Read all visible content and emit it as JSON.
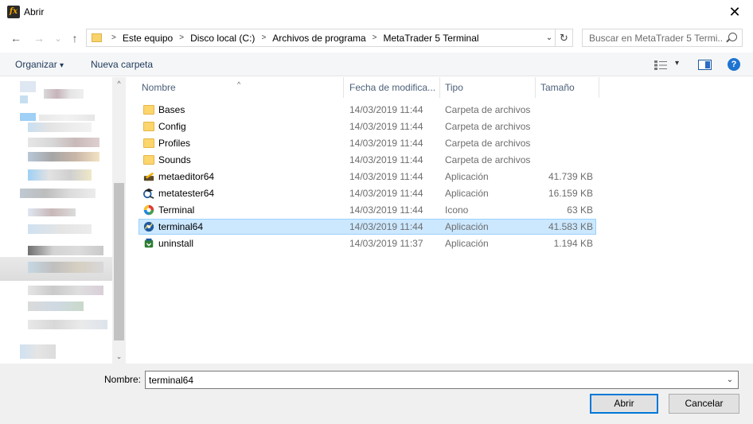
{
  "window": {
    "title": "Abrir",
    "app_icon_text": "fx",
    "close_glyph": "✕"
  },
  "nav": {
    "back": "←",
    "forward": "→",
    "recent": "⌄",
    "up": "↑"
  },
  "address": {
    "crumbs": [
      "Este equipo",
      "Disco local (C:)",
      "Archivos de programa",
      "MetaTrader 5 Terminal"
    ],
    "separator": ">",
    "dropdown": "⌄",
    "refresh": "↻"
  },
  "search": {
    "placeholder": "Buscar en MetaTrader 5 Termi..."
  },
  "toolbar": {
    "organize": "Organizar",
    "organize_arrow": "▾",
    "new_folder": "Nueva carpeta",
    "view_arrow": "▾",
    "help": "?"
  },
  "columns": {
    "name": "Nombre",
    "date": "Fecha de modifica...",
    "type": "Tipo",
    "size": "Tamaño",
    "sort_indicator": "^"
  },
  "files": [
    {
      "name": "Bases",
      "date": "14/03/2019 11:44",
      "type": "Carpeta de archivos",
      "size": "",
      "icon": "folder-icon"
    },
    {
      "name": "Config",
      "date": "14/03/2019 11:44",
      "type": "Carpeta de archivos",
      "size": "",
      "icon": "folder-icon"
    },
    {
      "name": "Profiles",
      "date": "14/03/2019 11:44",
      "type": "Carpeta de archivos",
      "size": "",
      "icon": "folder-icon"
    },
    {
      "name": "Sounds",
      "date": "14/03/2019 11:44",
      "type": "Carpeta de archivos",
      "size": "",
      "icon": "folder-icon"
    },
    {
      "name": "metaeditor64",
      "date": "14/03/2019 11:44",
      "type": "Aplicación",
      "size": "41.739 KB",
      "icon": "metaeditor-icon"
    },
    {
      "name": "metatester64",
      "date": "14/03/2019 11:44",
      "type": "Aplicación",
      "size": "16.159 KB",
      "icon": "metatester-icon"
    },
    {
      "name": "Terminal",
      "date": "14/03/2019 11:44",
      "type": "Icono",
      "size": "63 KB",
      "icon": "terminal-ico-icon"
    },
    {
      "name": "terminal64",
      "date": "14/03/2019 11:44",
      "type": "Aplicación",
      "size": "41.583 KB",
      "icon": "terminal-app-icon",
      "selected": true
    },
    {
      "name": "uninstall",
      "date": "14/03/2019 11:37",
      "type": "Aplicación",
      "size": "1.194 KB",
      "icon": "uninstall-icon"
    }
  ],
  "bottom": {
    "name_label": "Nombre:",
    "name_value": "terminal64",
    "name_dropdown": "⌄",
    "open_label": "Abrir",
    "cancel_label": "Cancelar"
  },
  "navpane_scroll": {
    "up": "^",
    "down": "⌄"
  },
  "colors": {
    "selection": "#cce8ff",
    "selection_border": "#99d1ff",
    "accent": "#0078d7",
    "folder": "#fcd56c"
  }
}
